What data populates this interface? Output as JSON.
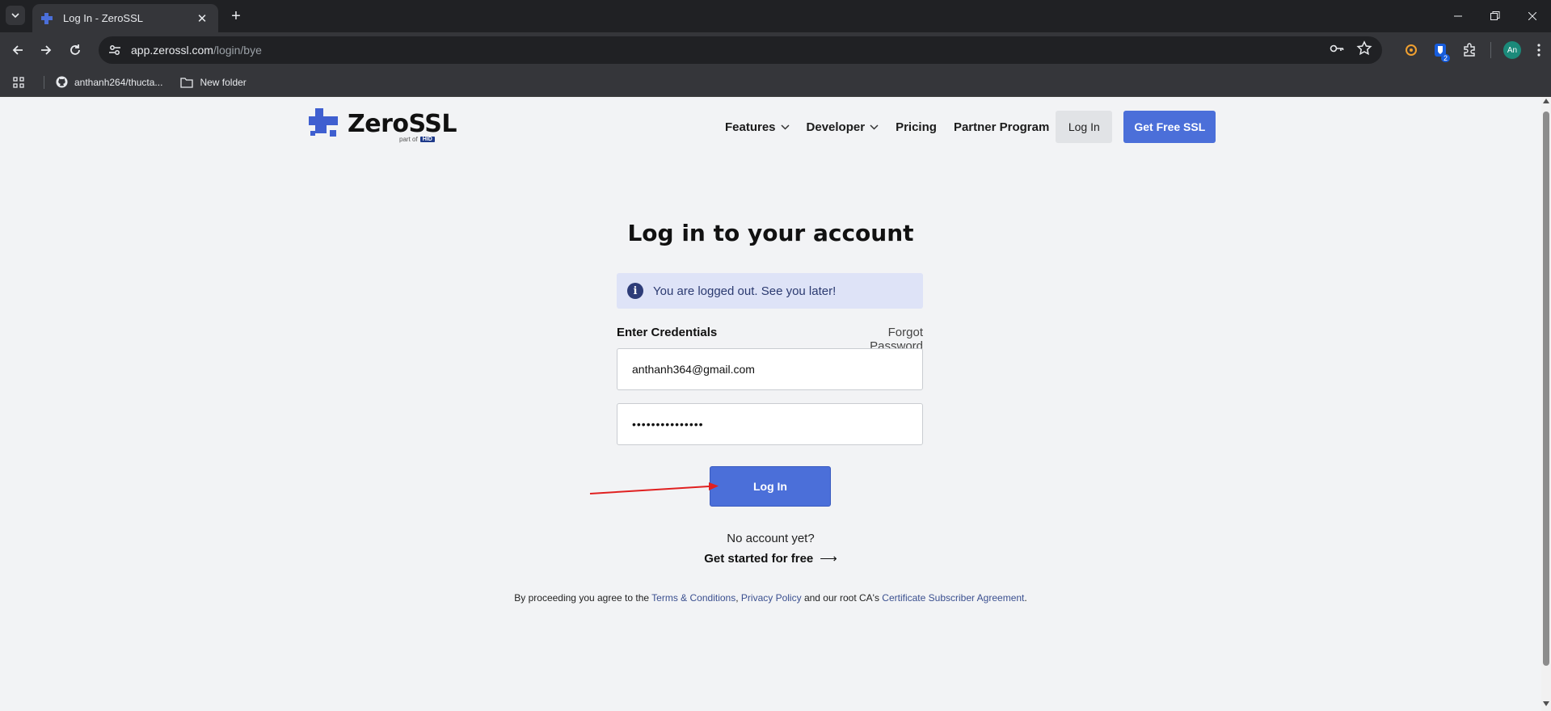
{
  "browser": {
    "tab_title": "Log In - ZeroSSL",
    "url_host": "app.zerossl.com",
    "url_path": "/login/bye",
    "profile_initials": "An",
    "extension_badge": "2",
    "bookmarks": [
      {
        "label": "anthanh264/thucta...",
        "icon": "github-icon"
      },
      {
        "label": "New folder",
        "icon": "folder-icon"
      }
    ]
  },
  "header": {
    "logo_text": "ZeroSSL",
    "logo_sub": "part of",
    "logo_badge": "HID",
    "nav": {
      "features": "Features",
      "developer": "Developer",
      "pricing": "Pricing",
      "partner": "Partner Program",
      "login": "Log In",
      "free_ssl": "Get Free SSL"
    },
    "brand_color": "#4b6fd9"
  },
  "login": {
    "title": "Log in to your account",
    "alert_text": "You are logged out. See you later!",
    "credentials_label": "Enter Credentials",
    "forgot_password": "Forgot Password",
    "email_value": "anthanh364@gmail.com",
    "password_value": "•••••••••••••••",
    "submit_label": "Log In",
    "no_account": "No account yet?",
    "get_started": "Get started for free",
    "legal": {
      "prefix": "By proceeding you agree to the",
      "terms": "Terms & Conditions",
      "comma": ",",
      "privacy": "Privacy Policy",
      "middle": "and our root CA's",
      "agreement": "Certificate Subscriber Agreement",
      "suffix": "."
    }
  },
  "annotation": {
    "arrow_color": "#e02020"
  }
}
